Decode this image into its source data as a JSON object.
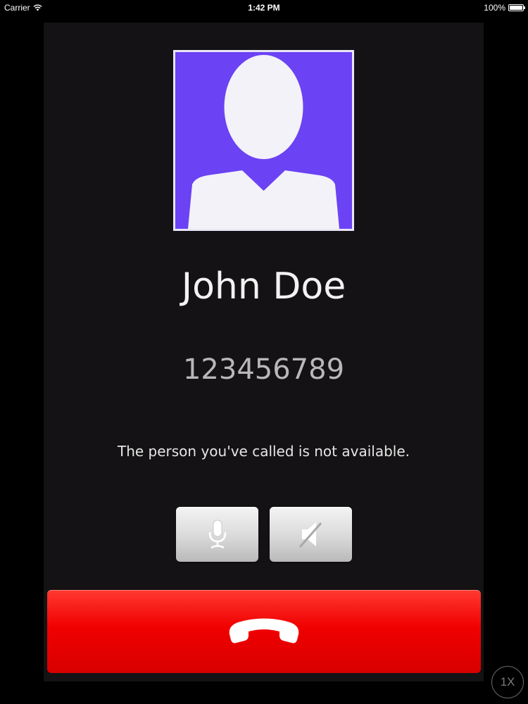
{
  "status_bar": {
    "carrier": "Carrier",
    "time": "1:42 PM",
    "battery_text": "100%",
    "battery_level": 1.0,
    "wifi_icon": "wifi-icon",
    "battery_icon": "battery-icon"
  },
  "call": {
    "caller_name": "John Doe",
    "caller_number": "123456789",
    "status_message": "The person you've called is not available.",
    "avatar_icon": "person-silhouette-icon"
  },
  "controls": {
    "mute_icon": "microphone-icon",
    "speaker_icon": "speaker-muted-icon",
    "end_call_icon": "phone-hangup-icon"
  },
  "overlay": {
    "speed_label": "1X"
  },
  "colors": {
    "panel_background": "#141214",
    "avatar_background": "#6b42f4",
    "end_call_red": "#f00000",
    "button_gray": "#d9d9d9"
  }
}
